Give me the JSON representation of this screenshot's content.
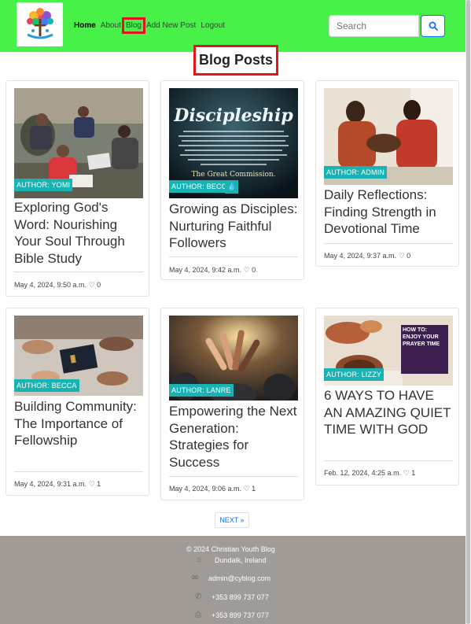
{
  "navbar": {
    "links": [
      {
        "label": "Home"
      },
      {
        "label": "About"
      },
      {
        "label": "Blog"
      },
      {
        "label": "Add New Post"
      },
      {
        "label": "Logout"
      }
    ],
    "search_placeholder": "Search"
  },
  "page": {
    "title": "Blog Posts"
  },
  "posts": [
    {
      "author": "AUTHOR: YOMI",
      "title": "Exploring God's Word: Nourishing Your Soul Through Bible Study",
      "date": "May 4, 2024, 9:50 a.m.",
      "likes": "0"
    },
    {
      "author": "AUTHOR: BECCA",
      "title": "Growing as Disciples: Nurturing Faithful Followers",
      "date": "May 4, 2024, 9:42 a.m.",
      "likes": "0",
      "image_text": "Discipleship",
      "image_caption": "The Great Commission."
    },
    {
      "author": "AUTHOR: ADMIN",
      "title": "Daily Reflections: Finding Strength in Devotional Time",
      "date": "May 4, 2024, 9:37 a.m.",
      "likes": "0"
    },
    {
      "author": "AUTHOR: BECCA",
      "title": "Building Community: The Importance of Fellowship",
      "date": "May 4, 2024, 9:31 a.m.",
      "likes": "1"
    },
    {
      "author": "AUTHOR: LANRE",
      "title": "Empowering the Next Generation: Strategies for Success",
      "date": "May 4, 2024, 9:06 a.m.",
      "likes": "1"
    },
    {
      "author": "AUTHOR: LIZZY",
      "title": "6 WAYS TO HAVE AN AMAZING QUIET TIME WITH GOD",
      "date": "Feb. 12, 2024, 4:25 a.m.",
      "likes": "1",
      "image_text": "HOW TO: ENJOY YOUR PRAYER TIME"
    }
  ],
  "pagination": {
    "next": "NEXT »"
  },
  "footer": {
    "copyright": "© 2024 Christian Youth Blog",
    "address": "Dundalk, Ireland",
    "email": "admin@cyblog.com",
    "phone": "+353 899 737 077",
    "fax": "+353 899 737 077"
  },
  "colors": {
    "navbar": "#47f147",
    "badge": "#1ab3b3",
    "highlight": "#e0141e",
    "footer": "#a09b96"
  }
}
